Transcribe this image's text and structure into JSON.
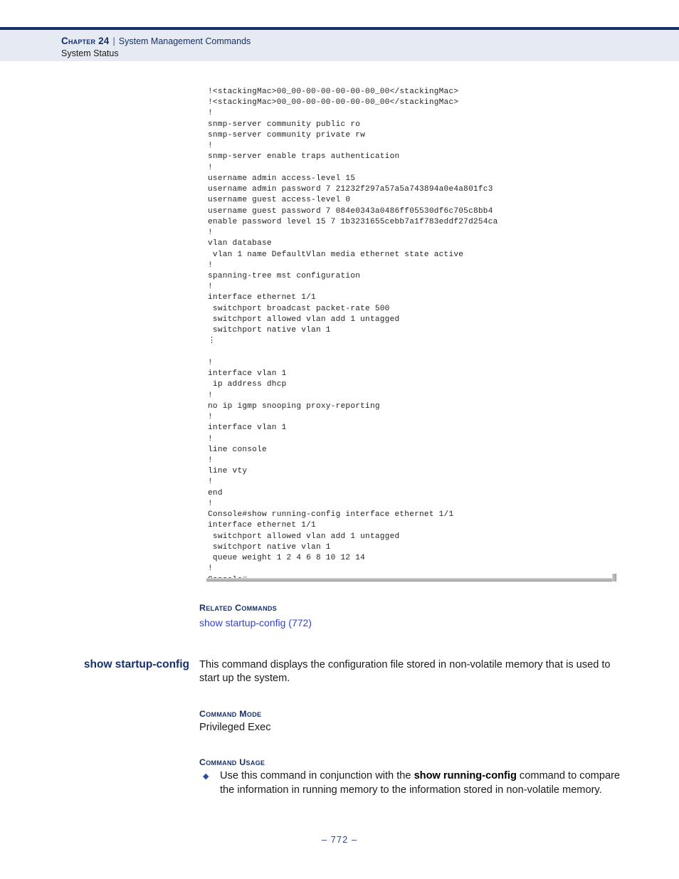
{
  "header": {
    "chapter": "Chapter 24",
    "separator": "|",
    "topic": "System Management Commands",
    "subtopic": "System Status",
    "accent_color": "#15306b",
    "band_color": "#e6eaf2"
  },
  "console_output": {
    "lines": "!<stackingMac>00_00-00-00-00-00-00_00</stackingMac>\n!<stackingMac>00_00-00-00-00-00-00_00</stackingMac>\n!\nsnmp-server community public ro\nsnmp-server community private rw\n!\nsnmp-server enable traps authentication\n!\nusername admin access-level 15\nusername admin password 7 21232f297a57a5a743894a0e4a801fc3\nusername guest access-level 0\nusername guest password 7 084e0343a0486ff05530df6c705c8bb4\nenable password level 15 7 1b3231655cebb7a1f783eddf27d254ca\n!\nvlan database\n vlan 1 name DefaultVlan media ethernet state active\n!\nspanning-tree mst configuration\n!\ninterface ethernet 1/1\n switchport broadcast packet-rate 500\n switchport allowed vlan add 1 untagged\n switchport native vlan 1\n⋮\n\n!\ninterface vlan 1\n ip address dhcp\n!\nno ip igmp snooping proxy-reporting\n!\ninterface vlan 1\n!\nline console\n!\nline vty\n!\nend\n!\nConsole#show running-config interface ethernet 1/1\ninterface ethernet 1/1\n switchport allowed vlan add 1 untagged\n switchport native vlan 1\n queue weight 1 2 4 6 8 10 12 14\n!\nConsole#"
  },
  "related_commands": {
    "label": "Related Commands",
    "link_text": "show startup-config (772)",
    "link_color": "#2f42d8"
  },
  "command": {
    "title": "show startup-config",
    "description": "This command displays the configuration file stored in non-volatile memory that is used to start up the system.",
    "command_mode": {
      "label": "Command Mode",
      "value": "Privileged Exec"
    },
    "command_usage": {
      "label": "Command Usage",
      "bullet_glyph": "◆",
      "items": [
        {
          "text_before": "Use this command in conjunction with the ",
          "emphasis": "show running-config",
          "text_after": " command to compare the information in running memory to the information stored in non-volatile memory."
        }
      ]
    }
  },
  "footer": {
    "page_number": "–  772  –"
  }
}
